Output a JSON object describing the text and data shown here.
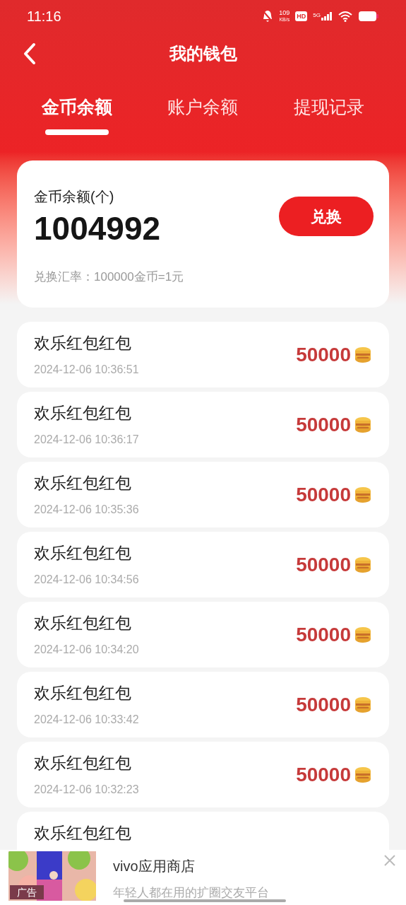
{
  "status_bar": {
    "time": "11:16",
    "speed": "109",
    "speed_unit": "KB/s",
    "hd": "HD",
    "network": "5G"
  },
  "header": {
    "title": "我的钱包"
  },
  "tabs": [
    {
      "label": "金币余额",
      "selected": true
    },
    {
      "label": "账户余额",
      "selected": false
    },
    {
      "label": "提现记录",
      "selected": false
    }
  ],
  "balance_card": {
    "label": "金币余额(个)",
    "value": "1004992",
    "button": "兑换",
    "rate": "兑换汇率：100000金币=1元"
  },
  "records": [
    {
      "title": "欢乐红包红包",
      "time": "2024-12-06 10:36:51",
      "amount": "50000"
    },
    {
      "title": "欢乐红包红包",
      "time": "2024-12-06 10:36:17",
      "amount": "50000"
    },
    {
      "title": "欢乐红包红包",
      "time": "2024-12-06 10:35:36",
      "amount": "50000"
    },
    {
      "title": "欢乐红包红包",
      "time": "2024-12-06 10:34:56",
      "amount": "50000"
    },
    {
      "title": "欢乐红包红包",
      "time": "2024-12-06 10:34:20",
      "amount": "50000"
    },
    {
      "title": "欢乐红包红包",
      "time": "2024-12-06 10:33:42",
      "amount": "50000"
    },
    {
      "title": "欢乐红包红包",
      "time": "2024-12-06 10:32:23",
      "amount": "50000"
    },
    {
      "title": "欢乐红包红包"
    }
  ],
  "ad": {
    "badge": "广告",
    "title": "vivo应用商店",
    "subtitle": "年轻人都在用的扩圈交友平台"
  }
}
